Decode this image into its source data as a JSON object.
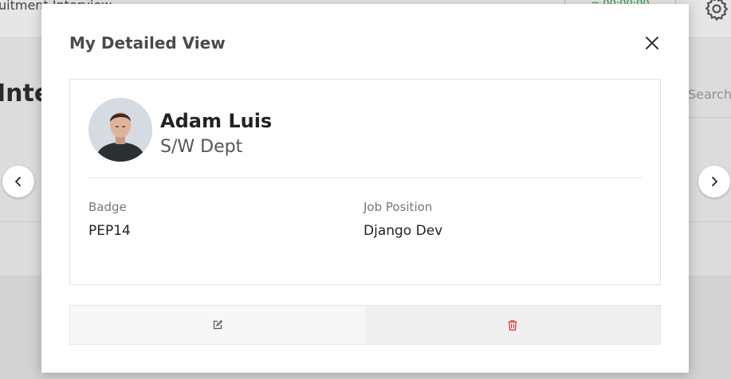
{
  "background": {
    "topbar_text": "uitment      Interview",
    "amount_text": "= 00:00:00",
    "heading": "Inte",
    "search_placeholder": "Search"
  },
  "modal": {
    "title": "My Detailed View",
    "close_icon": "close-icon"
  },
  "employee": {
    "name": "Adam Luis",
    "department": "S/W Dept",
    "avatar": "avatar-photo"
  },
  "fields": {
    "badge_label": "Badge",
    "badge_value": "PEP14",
    "job_label": "Job Position",
    "job_value": "Django Dev"
  },
  "actions": {
    "edit_icon": "edit-icon",
    "delete_icon": "trash-icon",
    "edit_color": "#555555",
    "delete_color": "#e0303a"
  },
  "navigation": {
    "prev_icon": "chevron-left-icon",
    "next_icon": "chevron-right-icon"
  }
}
